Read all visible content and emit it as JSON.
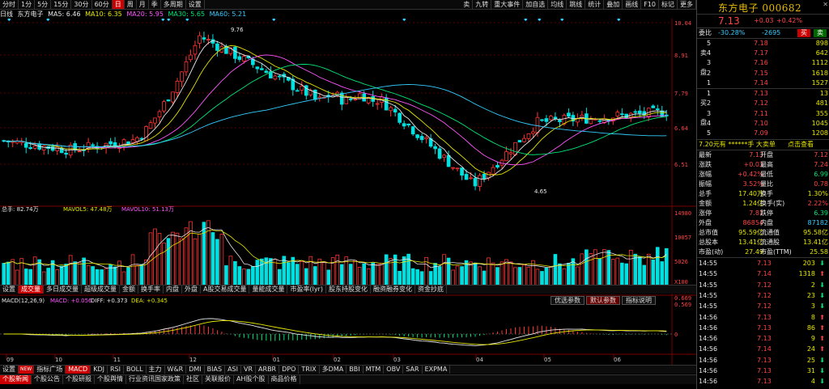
{
  "toolbar": {
    "left": [
      "分时",
      "1分",
      "5分",
      "15分",
      "30分",
      "60分",
      "日",
      "周",
      "月",
      "季",
      "多周期",
      "设置"
    ],
    "active_index": 6,
    "right": [
      "卖",
      "九转",
      "重大事件",
      "加自选",
      "均线",
      "跳线",
      "统计",
      "叠加",
      "画线",
      "F10",
      "标记",
      "更多"
    ]
  },
  "ma_line": {
    "stock": "日线",
    "stock_name": "东方电子",
    "ma5": "MA5: 6.46",
    "ma10": "MA10: 6.35",
    "ma20": "MA20: 5.95",
    "ma30": "MA30: 5.65",
    "ma60": "MA60: 5.21"
  },
  "price_axis": [
    "10.04",
    "8.91",
    "7.79",
    "6.64",
    "6.51"
  ],
  "annotations": {
    "high": "9.76",
    "low": "4.65"
  },
  "volume": {
    "label": "总手: 82.74万",
    "mavol5": "MAVOL5: 47.48万",
    "mavol10": "MAVOL10: 51.13万",
    "axis": [
      "14980",
      "10057",
      "5026",
      "X100"
    ]
  },
  "volume_tabs": [
    "设置",
    "成交量",
    "多日成交量",
    "超级成交量",
    "金额",
    "换手率",
    "内盘",
    "外盘",
    "A股交易成交量",
    "量能成交量",
    "市盈率(lyr)",
    "股东持股变化",
    "融资融券变化",
    "资金抄底"
  ],
  "volume_tab_active": 1,
  "macd": {
    "label": "MACD(12,26,9)",
    "macd": "MACD: +0.056",
    "diff": "DIFF: +0.373",
    "dea": "DEA: +0.345",
    "axis": [
      "0.669",
      "0.569",
      "0"
    ],
    "buttons": [
      "优选参数",
      "默认参数",
      "指标说明"
    ]
  },
  "date_axis": [
    "09",
    "10",
    "11",
    "12",
    "01",
    "02",
    "03",
    "04",
    "05",
    "06"
  ],
  "indicator_tabs": [
    "设置",
    "NEW",
    "指标广场",
    "MACD",
    "KDJ",
    "RSI",
    "BOLL",
    "主力",
    "W&R",
    "DMI",
    "BIAS",
    "ASI",
    "VR",
    "ARBR",
    "DPO",
    "TRIX",
    "多DMA",
    "BBI",
    "MTM",
    "OBV",
    "SAR",
    "EXPMA"
  ],
  "indicator_active": 3,
  "news_tabs": [
    "个股新闻",
    "个股公告",
    "个股研报",
    "个股舆情",
    "行业资讯国家政策",
    "社区",
    "关联报价",
    "AH股个股",
    "商品价格"
  ],
  "quote": {
    "name": "东方电子 000682",
    "price": "7.13",
    "change": "+0.03",
    "change_pct": "+0.42%",
    "weibi_label": "委比",
    "weibi": "-30.28%",
    "weicha": "-2695",
    "buy_btn": "买",
    "sell_btn": "卖",
    "asks": [
      {
        "label": "5",
        "price": "7.18",
        "vol": "898"
      },
      {
        "label": "4",
        "price": "7.17",
        "vol": "642"
      },
      {
        "label": "3",
        "price": "7.16",
        "vol": "1112"
      },
      {
        "label": "2",
        "price": "7.15",
        "vol": "1618"
      },
      {
        "label": "1",
        "price": "7.14",
        "vol": "1527"
      }
    ],
    "bids": [
      {
        "label": "1",
        "price": "7.13",
        "vol": "13"
      },
      {
        "label": "2",
        "price": "7.12",
        "vol": "481"
      },
      {
        "label": "3",
        "price": "7.11",
        "vol": "355"
      },
      {
        "label": "4",
        "price": "7.10",
        "vol": "1045"
      },
      {
        "label": "5",
        "price": "7.09",
        "vol": "1208"
      }
    ],
    "ask_side": "卖",
    "bid_side": "买",
    "bid_side_labels": [
      "买",
      "盘"
    ],
    "ask_side_labels": [
      "卖",
      "盘"
    ],
    "banner": "7.20元有 ******手 大卖单",
    "banner_link": "点击查看",
    "stats": [
      [
        "最新",
        "7.13",
        "开盘",
        "7.12"
      ],
      [
        "涨跌",
        "+0.03",
        "最高",
        "7.24"
      ],
      [
        "涨幅",
        "+0.42%",
        "最低",
        "6.99"
      ],
      [
        "振幅",
        "3.52%",
        "量比",
        "0.78"
      ],
      [
        "总手",
        "17.40万",
        "换手",
        "1.30%"
      ],
      [
        "金额",
        "1.24亿",
        "换手(实)",
        "2.22%"
      ],
      [
        "涨停",
        "7.81",
        "跌停",
        "6.39"
      ],
      [
        "外盘",
        "86854",
        "内盘",
        "87182"
      ],
      [
        "总市值",
        "95.59亿",
        "流通值",
        "95.58亿"
      ],
      [
        "总股本",
        "13.41亿",
        "流通股",
        "13.41亿"
      ],
      [
        "市盈(动)",
        "27.49",
        "市盈(TTM)",
        "25.58"
      ]
    ],
    "ticks": [
      {
        "time": "14:55",
        "price": "7.13",
        "vol": "203",
        "dir": "down"
      },
      {
        "time": "14:55",
        "price": "7.14",
        "vol": "1318",
        "dir": "up"
      },
      {
        "time": "14:55",
        "price": "7.12",
        "vol": "2",
        "dir": "down"
      },
      {
        "time": "14:55",
        "price": "7.12",
        "vol": "23",
        "dir": "down"
      },
      {
        "time": "14:55",
        "price": "7.12",
        "vol": "3",
        "dir": "down"
      },
      {
        "time": "14:56",
        "price": "7.13",
        "vol": "8",
        "dir": "up"
      },
      {
        "time": "14:56",
        "price": "7.13",
        "vol": "86",
        "dir": "up"
      },
      {
        "time": "14:56",
        "price": "7.13",
        "vol": "9",
        "dir": "up"
      },
      {
        "time": "14:56",
        "price": "7.14",
        "vol": "24",
        "dir": "up"
      },
      {
        "time": "14:56",
        "price": "7.13",
        "vol": "25",
        "dir": "down"
      },
      {
        "time": "14:56",
        "price": "7.13",
        "vol": "31",
        "dir": "down"
      },
      {
        "time": "14:56",
        "price": "7.13",
        "vol": "4",
        "dir": "down"
      }
    ]
  },
  "colors": {
    "up": "#ff3333",
    "down": "#00e0e0",
    "bg": "#000000",
    "accent": "#cc0000",
    "yellow": "#e6b800",
    "green": "#00e676"
  }
}
